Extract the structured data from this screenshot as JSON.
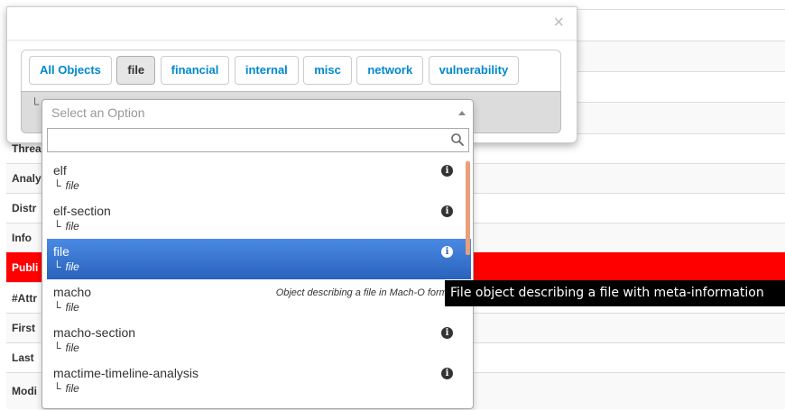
{
  "modal": {
    "close_label": "×"
  },
  "tabs": [
    {
      "label": "All Objects",
      "active": false
    },
    {
      "label": "file",
      "active": true
    },
    {
      "label": "financial",
      "active": false
    },
    {
      "label": "internal",
      "active": false
    },
    {
      "label": "misc",
      "active": false
    },
    {
      "label": "network",
      "active": false
    },
    {
      "label": "vulnerability",
      "active": false
    }
  ],
  "select": {
    "tree_mark": "└",
    "placeholder": "Select an Option",
    "search_value": ""
  },
  "results": [
    {
      "name": "elf",
      "category": "file",
      "description": "",
      "info_icon": "info-circle",
      "highlighted": false
    },
    {
      "name": "elf-section",
      "category": "file",
      "description": "",
      "info_icon": "info-circle",
      "highlighted": false
    },
    {
      "name": "file",
      "category": "file",
      "description": "",
      "info_icon": "info-circle",
      "highlighted": true
    },
    {
      "name": "macho",
      "category": "file",
      "description": "Object describing a file in Mach-O format",
      "info_icon": "",
      "highlighted": false
    },
    {
      "name": "macho-section",
      "category": "file",
      "description": "",
      "info_icon": "info-circle",
      "highlighted": false
    },
    {
      "name": "mactime-timeline-analysis",
      "category": "file",
      "description": "",
      "info_icon": "info-circle",
      "highlighted": false
    }
  ],
  "tree_mark": "└",
  "tooltip": {
    "text": "File object describing a file with meta-information"
  },
  "background_rows": [
    {
      "label": "",
      "style": "plain"
    },
    {
      "label": "",
      "style": "odd"
    },
    {
      "label": "",
      "style": "plain"
    },
    {
      "label": "",
      "style": "odd"
    },
    {
      "label": "Threa",
      "style": "plain"
    },
    {
      "label": "Analy",
      "style": "odd"
    },
    {
      "label": "Distr",
      "style": "plain"
    },
    {
      "label": "Info",
      "style": "odd"
    },
    {
      "label": "Publi",
      "style": "red"
    },
    {
      "label": "#Attr",
      "style": "plain"
    },
    {
      "label": "First",
      "style": "odd"
    },
    {
      "label": "Last",
      "style": "plain"
    },
    {
      "label": "Modi",
      "style": "odd"
    }
  ],
  "colors": {
    "accent": "#0088cc",
    "highlight": "#3875d7",
    "published_red": "#ff0000",
    "scrollbar": "#e8a07a"
  }
}
